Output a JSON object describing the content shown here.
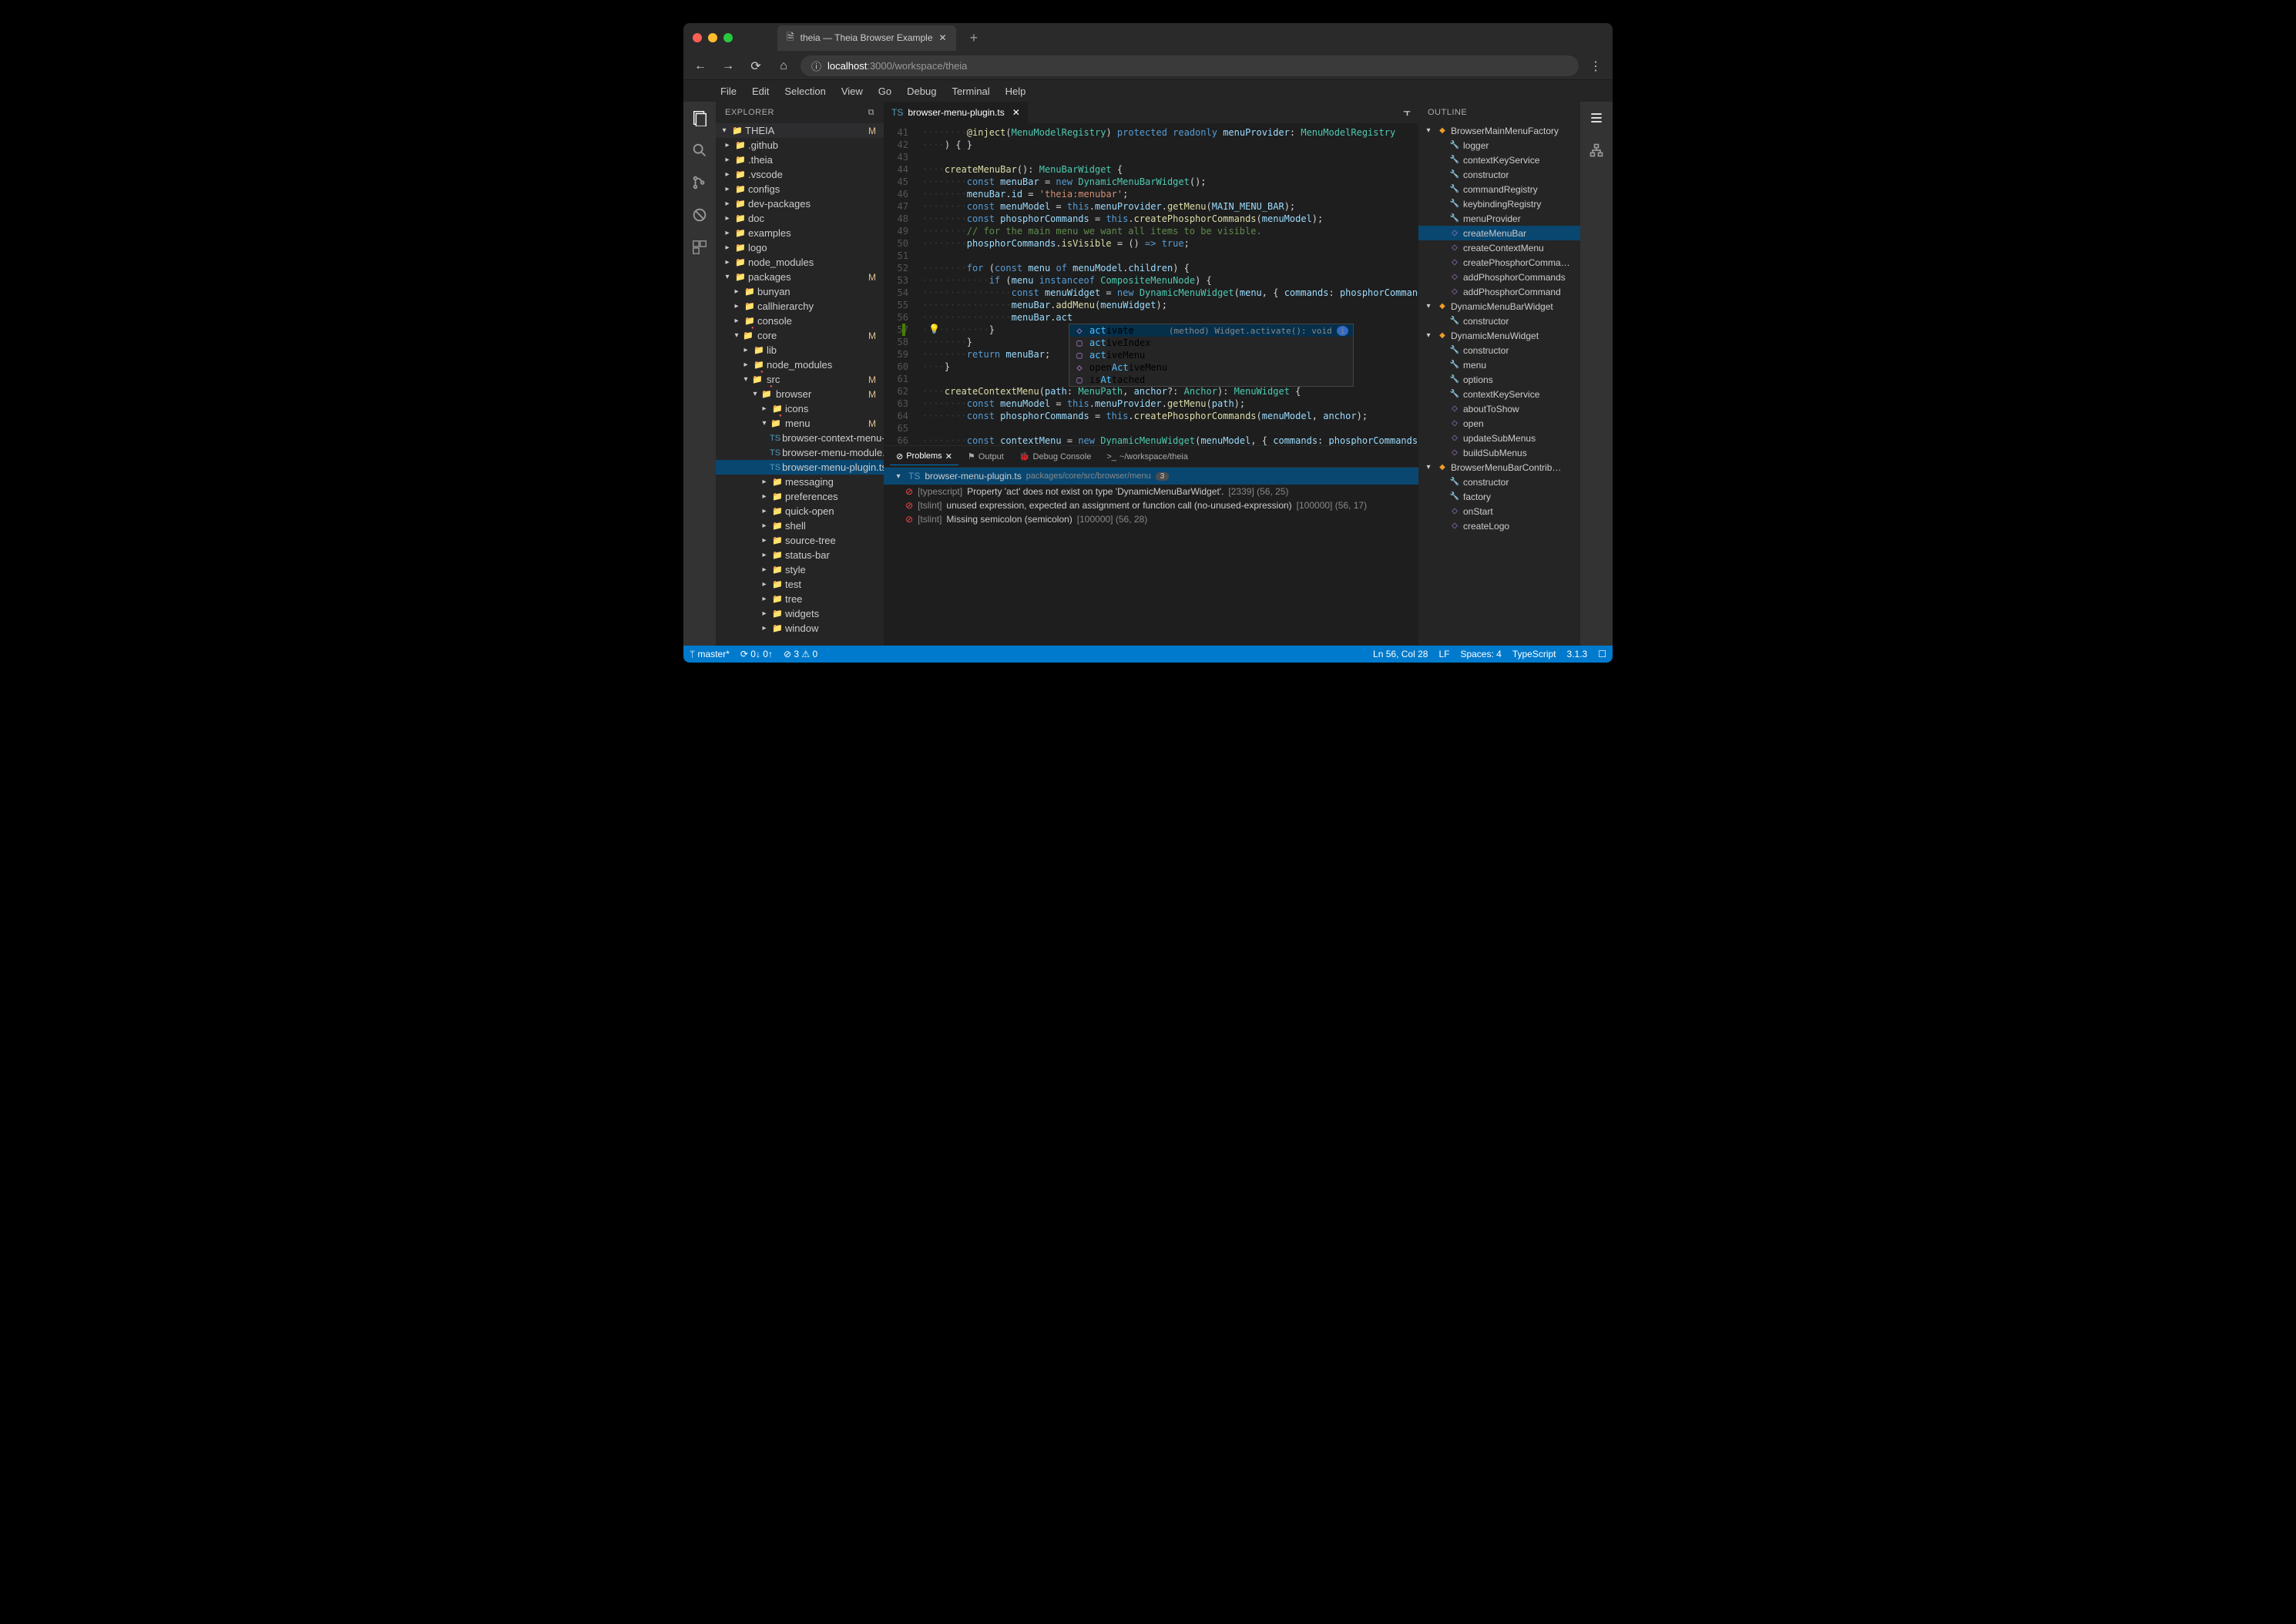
{
  "browser": {
    "tab_title": "theia — Theia Browser Example",
    "url_host": "localhost",
    "url_path": ":3000/workspace/theia"
  },
  "menubar": [
    "File",
    "Edit",
    "Selection",
    "View",
    "Go",
    "Debug",
    "Terminal",
    "Help"
  ],
  "explorer": {
    "title": "EXPLORER",
    "root": "THEIA",
    "root_mod": "M",
    "items": [
      {
        "name": ".github",
        "kind": "folder",
        "depth": 0,
        "exp": false
      },
      {
        "name": ".theia",
        "kind": "folder",
        "depth": 0,
        "exp": false
      },
      {
        "name": ".vscode",
        "kind": "folder",
        "depth": 0,
        "exp": false
      },
      {
        "name": "configs",
        "kind": "folder",
        "depth": 0,
        "exp": false
      },
      {
        "name": "dev-packages",
        "kind": "folder",
        "depth": 0,
        "exp": false
      },
      {
        "name": "doc",
        "kind": "folder",
        "depth": 0,
        "exp": false
      },
      {
        "name": "examples",
        "kind": "folder",
        "depth": 0,
        "exp": false
      },
      {
        "name": "logo",
        "kind": "folder",
        "depth": 0,
        "exp": false
      },
      {
        "name": "node_modules",
        "kind": "folder",
        "depth": 0,
        "exp": false
      },
      {
        "name": "packages",
        "kind": "folder",
        "depth": 0,
        "exp": true,
        "mod": "M"
      },
      {
        "name": "bunyan",
        "kind": "folder",
        "depth": 1,
        "exp": false
      },
      {
        "name": "callhierarchy",
        "kind": "folder",
        "depth": 1,
        "exp": false
      },
      {
        "name": "console",
        "kind": "folder",
        "depth": 1,
        "exp": false
      },
      {
        "name": "core",
        "kind": "folder",
        "depth": 1,
        "exp": true,
        "mod": "M",
        "err": true
      },
      {
        "name": "lib",
        "kind": "folder",
        "depth": 2,
        "exp": false
      },
      {
        "name": "node_modules",
        "kind": "folder",
        "depth": 2,
        "exp": false
      },
      {
        "name": "src",
        "kind": "folder",
        "depth": 2,
        "exp": true,
        "mod": "M",
        "err": true
      },
      {
        "name": "browser",
        "kind": "folder",
        "depth": 3,
        "exp": true,
        "mod": "M",
        "err": true
      },
      {
        "name": "icons",
        "kind": "folder",
        "depth": 4,
        "exp": false
      },
      {
        "name": "menu",
        "kind": "folder",
        "depth": 4,
        "exp": true,
        "mod": "M",
        "err": true
      },
      {
        "name": "browser-context-menu-r…",
        "kind": "file",
        "depth": 5
      },
      {
        "name": "browser-menu-module.ts",
        "kind": "file",
        "depth": 5
      },
      {
        "name": "browser-menu-plugin.ts",
        "kind": "file",
        "depth": 5,
        "mod": "M",
        "sel": true
      },
      {
        "name": "messaging",
        "kind": "folder",
        "depth": 4,
        "exp": false
      },
      {
        "name": "preferences",
        "kind": "folder",
        "depth": 4,
        "exp": false
      },
      {
        "name": "quick-open",
        "kind": "folder",
        "depth": 4,
        "exp": false
      },
      {
        "name": "shell",
        "kind": "folder",
        "depth": 4,
        "exp": false
      },
      {
        "name": "source-tree",
        "kind": "folder",
        "depth": 4,
        "exp": false
      },
      {
        "name": "status-bar",
        "kind": "folder",
        "depth": 4,
        "exp": false
      },
      {
        "name": "style",
        "kind": "folder",
        "depth": 4,
        "exp": false
      },
      {
        "name": "test",
        "kind": "folder",
        "depth": 4,
        "exp": false
      },
      {
        "name": "tree",
        "kind": "folder",
        "depth": 4,
        "exp": false
      },
      {
        "name": "widgets",
        "kind": "folder",
        "depth": 4,
        "exp": false
      },
      {
        "name": "window",
        "kind": "folder",
        "depth": 4,
        "exp": false
      }
    ]
  },
  "editor_tab": "browser-menu-plugin.ts",
  "code_lines": [
    {
      "n": 41,
      "html": "<span class='ws'>········</span><span class='fn'>@inject</span>(<span class='type'>MenuModelRegistry</span>) <span class='kw'>protected</span> <span class='kw'>readonly</span> <span class='var'>menuProvider</span>: <span class='type'>MenuModelRegistry</span>"
    },
    {
      "n": 42,
      "html": "<span class='ws'>····</span>) { }"
    },
    {
      "n": 43,
      "html": ""
    },
    {
      "n": 44,
      "html": "<span class='ws'>····</span><span class='fn'>createMenuBar</span>(): <span class='type'>MenuBarWidget</span> {"
    },
    {
      "n": 45,
      "html": "<span class='ws'>········</span><span class='kw'>const</span> <span class='var'>menuBar</span> = <span class='kw'>new</span> <span class='type'>DynamicMenuBarWidget</span>();"
    },
    {
      "n": 46,
      "html": "<span class='ws'>········</span><span class='var'>menuBar</span>.<span class='var'>id</span> = <span class='str'>'theia:menubar'</span>;"
    },
    {
      "n": 47,
      "html": "<span class='ws'>········</span><span class='kw'>const</span> <span class='var'>menuModel</span> = <span class='kw'>this</span>.<span class='var'>menuProvider</span>.<span class='fn'>getMenu</span>(<span class='var'>MAIN_MENU_BAR</span>);"
    },
    {
      "n": 48,
      "html": "<span class='ws'>········</span><span class='kw'>const</span> <span class='var'>phosphorCommands</span> = <span class='kw'>this</span>.<span class='fn'>createPhosphorCommands</span>(<span class='var'>menuModel</span>);"
    },
    {
      "n": 49,
      "html": "<span class='ws'>········</span><span class='cmt'>// for the main menu we want all items to be visible.</span>"
    },
    {
      "n": 50,
      "html": "<span class='ws'>········</span><span class='var'>phosphorCommands</span>.<span class='fn'>isVisible</span> = () <span class='kw'>=&gt;</span> <span class='kw'>true</span>;"
    },
    {
      "n": 51,
      "html": ""
    },
    {
      "n": 52,
      "html": "<span class='ws'>········</span><span class='kw'>for</span> (<span class='kw'>const</span> <span class='var'>menu</span> <span class='kw'>of</span> <span class='var'>menuModel</span>.<span class='var'>children</span>) {"
    },
    {
      "n": 53,
      "html": "<span class='ws'>············</span><span class='kw'>if</span> (<span class='var'>menu</span> <span class='kw'>instanceof</span> <span class='type'>CompositeMenuNode</span>) {"
    },
    {
      "n": 54,
      "html": "<span class='ws'>················</span><span class='kw'>const</span> <span class='var'>menuWidget</span> = <span class='kw'>new</span> <span class='type'>DynamicMenuWidget</span>(<span class='var'>menu</span>, { <span class='var'>commands</span>: <span class='var'>phosphorCommands</span> }, <span class='kw'>this</span>.<span class='var'>co</span>"
    },
    {
      "n": 55,
      "html": "<span class='ws'>················</span><span class='var'>menuBar</span>.<span class='fn'>addMenu</span>(<span class='var'>menuWidget</span>);"
    },
    {
      "n": 56,
      "html": "<span class='ws'>················</span><span class='var'>menuBar</span>.<span class='var'>act</span>"
    },
    {
      "n": 57,
      "html": "<span class='ws'>············</span>}"
    },
    {
      "n": 58,
      "html": "<span class='ws'>········</span>}"
    },
    {
      "n": 59,
      "html": "<span class='ws'>········</span><span class='kw'>return</span> <span class='var'>menuBar</span>;"
    },
    {
      "n": 60,
      "html": "<span class='ws'>····</span>}"
    },
    {
      "n": 61,
      "html": ""
    },
    {
      "n": 62,
      "html": "<span class='ws'>····</span><span class='fn'>createContextMenu</span>(<span class='var'>path</span>: <span class='type'>MenuPath</span>, <span class='var'>anchor</span>?: <span class='type'>Anchor</span>): <span class='type'>MenuWidget</span> {"
    },
    {
      "n": 63,
      "html": "<span class='ws'>········</span><span class='kw'>const</span> <span class='var'>menuModel</span> = <span class='kw'>this</span>.<span class='var'>menuProvider</span>.<span class='fn'>getMenu</span>(<span class='var'>path</span>);"
    },
    {
      "n": 64,
      "html": "<span class='ws'>········</span><span class='kw'>const</span> <span class='var'>phosphorCommands</span> = <span class='kw'>this</span>.<span class='fn'>createPhosphorCommands</span>(<span class='var'>menuModel</span>, <span class='var'>anchor</span>);"
    },
    {
      "n": 65,
      "html": ""
    },
    {
      "n": 66,
      "html": "<span class='ws'>········</span><span class='kw'>const</span> <span class='var'>contextMenu</span> = <span class='kw'>new</span> <span class='type'>DynamicMenuWidget</span>(<span class='var'>menuModel</span>, { <span class='var'>commands</span>: <span class='var'>phosphorCommands</span> }, <span class='kw'>this</span>.<span class='var'>cont</span>"
    }
  ],
  "completion": {
    "hint": "(method) Widget.activate(): void",
    "items": [
      {
        "label": "activate",
        "match": "act",
        "rest": "ivate",
        "kind": "method",
        "sel": true
      },
      {
        "label": "activeIndex",
        "match": "act",
        "rest": "iveIndex",
        "kind": "prop"
      },
      {
        "label": "activeMenu",
        "match": "act",
        "rest": "iveMenu",
        "kind": "prop"
      },
      {
        "label": "openActiveMenu",
        "pre": "open",
        "match": "Act",
        "rest": "iveMenu",
        "kind": "method"
      },
      {
        "label": "isAttached",
        "pre": "is",
        "match": "At",
        "mid": "t",
        "rest": "ached",
        "kind": "prop"
      }
    ]
  },
  "panel": {
    "tabs": [
      {
        "label": "Problems",
        "icon": "⊘",
        "active": true,
        "close": true
      },
      {
        "label": "Output",
        "icon": "⚑"
      },
      {
        "label": "Debug Console",
        "icon": "🐞"
      },
      {
        "label": "~/workspace/theia",
        "icon": ">_"
      }
    ],
    "file_header": {
      "name": "browser-menu-plugin.ts",
      "path": "packages/core/src/browser/menu",
      "count": "3"
    },
    "problems": [
      {
        "src": "[typescript]",
        "msg": "Property 'act' does not exist on type 'DynamicMenuBarWidget'.",
        "code": "[2339]",
        "loc": "(56, 25)"
      },
      {
        "src": "[tslint]",
        "msg": "unused expression, expected an assignment or function call (no-unused-expression)",
        "code": "[100000]",
        "loc": "(56, 17)"
      },
      {
        "src": "[tslint]",
        "msg": "Missing semicolon (semicolon)",
        "code": "[100000]",
        "loc": "(56, 28)"
      }
    ]
  },
  "outline": {
    "title": "OUTLINE",
    "items": [
      {
        "name": "BrowserMainMenuFactory",
        "kind": "class",
        "depth": 0,
        "exp": true
      },
      {
        "name": "logger",
        "kind": "prop",
        "depth": 1
      },
      {
        "name": "contextKeyService",
        "kind": "prop",
        "depth": 1
      },
      {
        "name": "constructor",
        "kind": "prop",
        "depth": 1
      },
      {
        "name": "commandRegistry",
        "kind": "prop",
        "depth": 1
      },
      {
        "name": "keybindingRegistry",
        "kind": "prop",
        "depth": 1
      },
      {
        "name": "menuProvider",
        "kind": "prop",
        "depth": 1
      },
      {
        "name": "createMenuBar",
        "kind": "method",
        "depth": 1,
        "sel": true
      },
      {
        "name": "createContextMenu",
        "kind": "method",
        "depth": 1
      },
      {
        "name": "createPhosphorComma…",
        "kind": "method",
        "depth": 1
      },
      {
        "name": "addPhosphorCommands",
        "kind": "method",
        "depth": 1
      },
      {
        "name": "addPhosphorCommand",
        "kind": "method",
        "depth": 1
      },
      {
        "name": "DynamicMenuBarWidget",
        "kind": "class",
        "depth": 0,
        "exp": true
      },
      {
        "name": "constructor",
        "kind": "prop",
        "depth": 1
      },
      {
        "name": "DynamicMenuWidget",
        "kind": "class",
        "depth": 0,
        "exp": true
      },
      {
        "name": "constructor",
        "kind": "prop",
        "depth": 1
      },
      {
        "name": "menu",
        "kind": "prop",
        "depth": 1
      },
      {
        "name": "options",
        "kind": "prop",
        "depth": 1
      },
      {
        "name": "contextKeyService",
        "kind": "prop",
        "depth": 1
      },
      {
        "name": "aboutToShow",
        "kind": "method",
        "depth": 1
      },
      {
        "name": "open",
        "kind": "method",
        "depth": 1
      },
      {
        "name": "updateSubMenus",
        "kind": "method",
        "depth": 1
      },
      {
        "name": "buildSubMenus",
        "kind": "method",
        "depth": 1
      },
      {
        "name": "BrowserMenuBarContrib…",
        "kind": "class",
        "depth": 0,
        "exp": true
      },
      {
        "name": "constructor",
        "kind": "prop",
        "depth": 1
      },
      {
        "name": "factory",
        "kind": "prop",
        "depth": 1
      },
      {
        "name": "onStart",
        "kind": "method",
        "depth": 1
      },
      {
        "name": "createLogo",
        "kind": "method",
        "depth": 1
      }
    ]
  },
  "statusbar": {
    "branch": "master*",
    "sync": "⟳ 0↓ 0↑",
    "errors": "⊘ 3 ⚠ 0",
    "line_col": "Ln 56, Col 28",
    "eol": "LF",
    "indent": "Spaces: 4",
    "lang": "TypeScript",
    "version": "3.1.3",
    "bell": "☐"
  }
}
